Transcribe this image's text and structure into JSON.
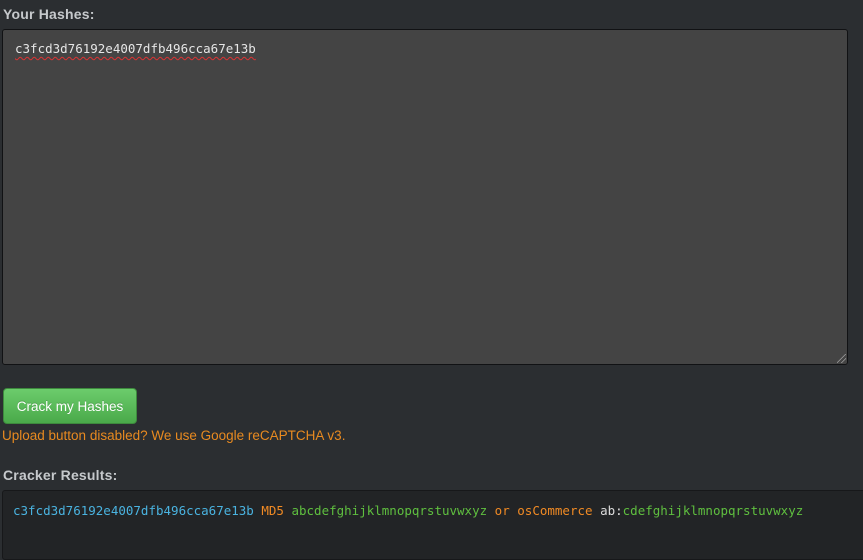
{
  "hashes_section": {
    "label": "Your Hashes:",
    "input_value": "c3fcd3d76192e4007dfb496cca67e13b"
  },
  "crack_button": {
    "label": "Crack my Hashes"
  },
  "notice": {
    "text": "Upload button disabled? We use Google reCAPTCHA v3."
  },
  "results_section": {
    "label": "Cracker Results:",
    "rows": [
      {
        "hash": "c3fcd3d76192e4007dfb496cca67e13b",
        "type": "MD5",
        "plaintext": "abcdefghijklmnopqrstuvwxyz",
        "separator": "or",
        "alt_type": "osCommerce",
        "salt_prefix": "ab:",
        "alt_plaintext": "cdefghijklmnopqrstuvwxyz"
      }
    ]
  },
  "colors": {
    "background": "#2b2e31",
    "textarea_bg": "#444444",
    "button_green": "#5cb85c",
    "notice_orange": "#e88a20",
    "hash_blue": "#4ab3e0",
    "plain_green": "#5fbf3f"
  }
}
